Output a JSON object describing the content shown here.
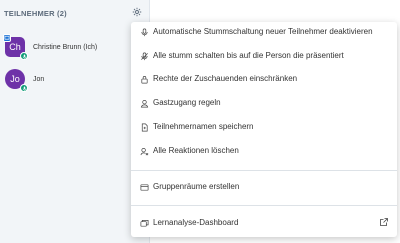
{
  "sidebar": {
    "title": "TEILNEHMER (2)",
    "users": [
      {
        "initials": "Ch",
        "name": "Christine Brunn (Ich)",
        "color": "#6e32a8"
      },
      {
        "initials": "Jo",
        "name": "Jon",
        "color": "#6e32a8"
      }
    ]
  },
  "menu": {
    "items": [
      {
        "icon": "microphone-icon",
        "label": "Automatische Stummschaltung neuer Teilnehmer deaktivieren"
      },
      {
        "icon": "microphone-off-icon",
        "label": "Alle stumm schalten bis auf die Person die präsentiert"
      },
      {
        "icon": "lock-icon",
        "label": "Rechte der Zuschauenden einschränken"
      },
      {
        "icon": "user-icon",
        "label": "Gastzugang regeln"
      },
      {
        "icon": "document-icon",
        "label": "Teilnehmernamen speichern"
      },
      {
        "icon": "user-remove-icon",
        "label": "Alle Reaktionen löschen"
      },
      {
        "icon": "rooms-icon",
        "label": "Gruppenräume erstellen"
      },
      {
        "icon": "dashboard-icon",
        "label": "Lernanalyse-Dashboard"
      }
    ],
    "external_icon": "external-link-icon"
  },
  "colors": {
    "accent": "#1b72d6",
    "avatar": "#6e32a8",
    "voice_badge": "#109c77"
  }
}
